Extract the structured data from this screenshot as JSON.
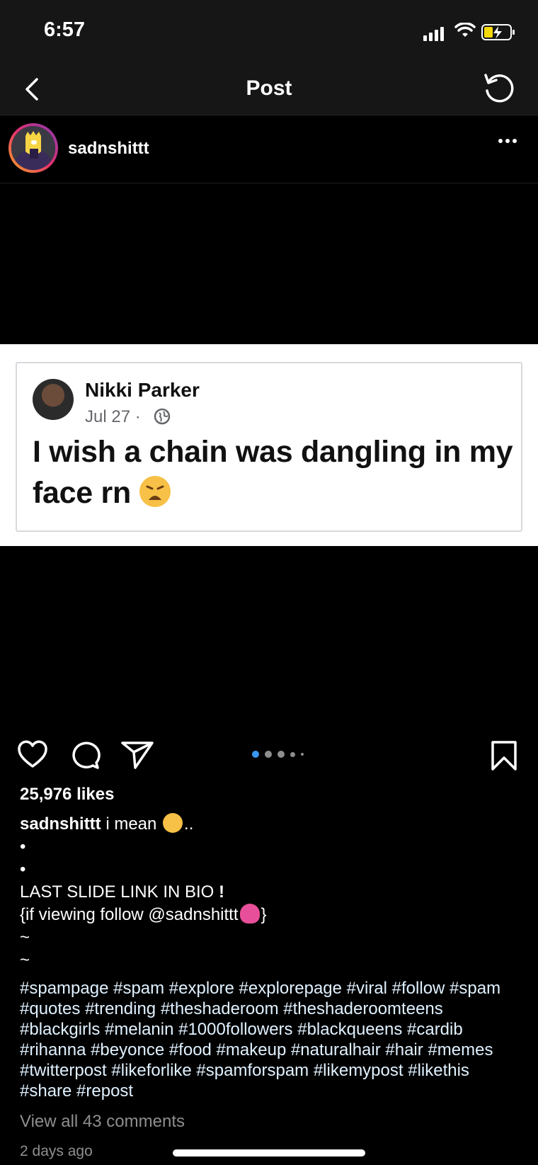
{
  "status_bar": {
    "time": "6:57"
  },
  "nav": {
    "title": "Post"
  },
  "post": {
    "username": "sadnshittt",
    "media": {
      "tweet_name": "Nikki Parker",
      "tweet_date": "Jul 27 ·",
      "tweet_text": "I wish a chain was dangling in my face rn"
    },
    "carousel": {
      "count": 5,
      "active_index": 0
    },
    "likes": "25,976 likes",
    "caption": {
      "user": "sadnshittt",
      "first_line": " i mean ",
      "first_line_end": "..",
      "bullet1": "•",
      "bullet2": "•",
      "line_last_slide": "LAST SLIDE LINK IN BIO",
      "line_follow_start": "{if viewing follow @sadnshittt",
      "line_follow_end": "}",
      "tilde1": "~",
      "tilde2": "~",
      "hashtags": "#spampage #spam #explore #explorepage #viral #follow #spam #quotes #trending #theshaderoom #theshaderoomteens #blackgirls #melanin #1000followers #blackqueens #cardib #rihanna #beyonce #food #makeup #naturalhair #hair #memes #twitterpost #likeforlike #spamforspam #likemypost #likethis #share #repost"
    },
    "view_comments": "View all 43 comments",
    "time_ago": "2 days ago"
  },
  "colors": {
    "accent_blue": "#3897f0",
    "muted": "#8e8e8e"
  }
}
